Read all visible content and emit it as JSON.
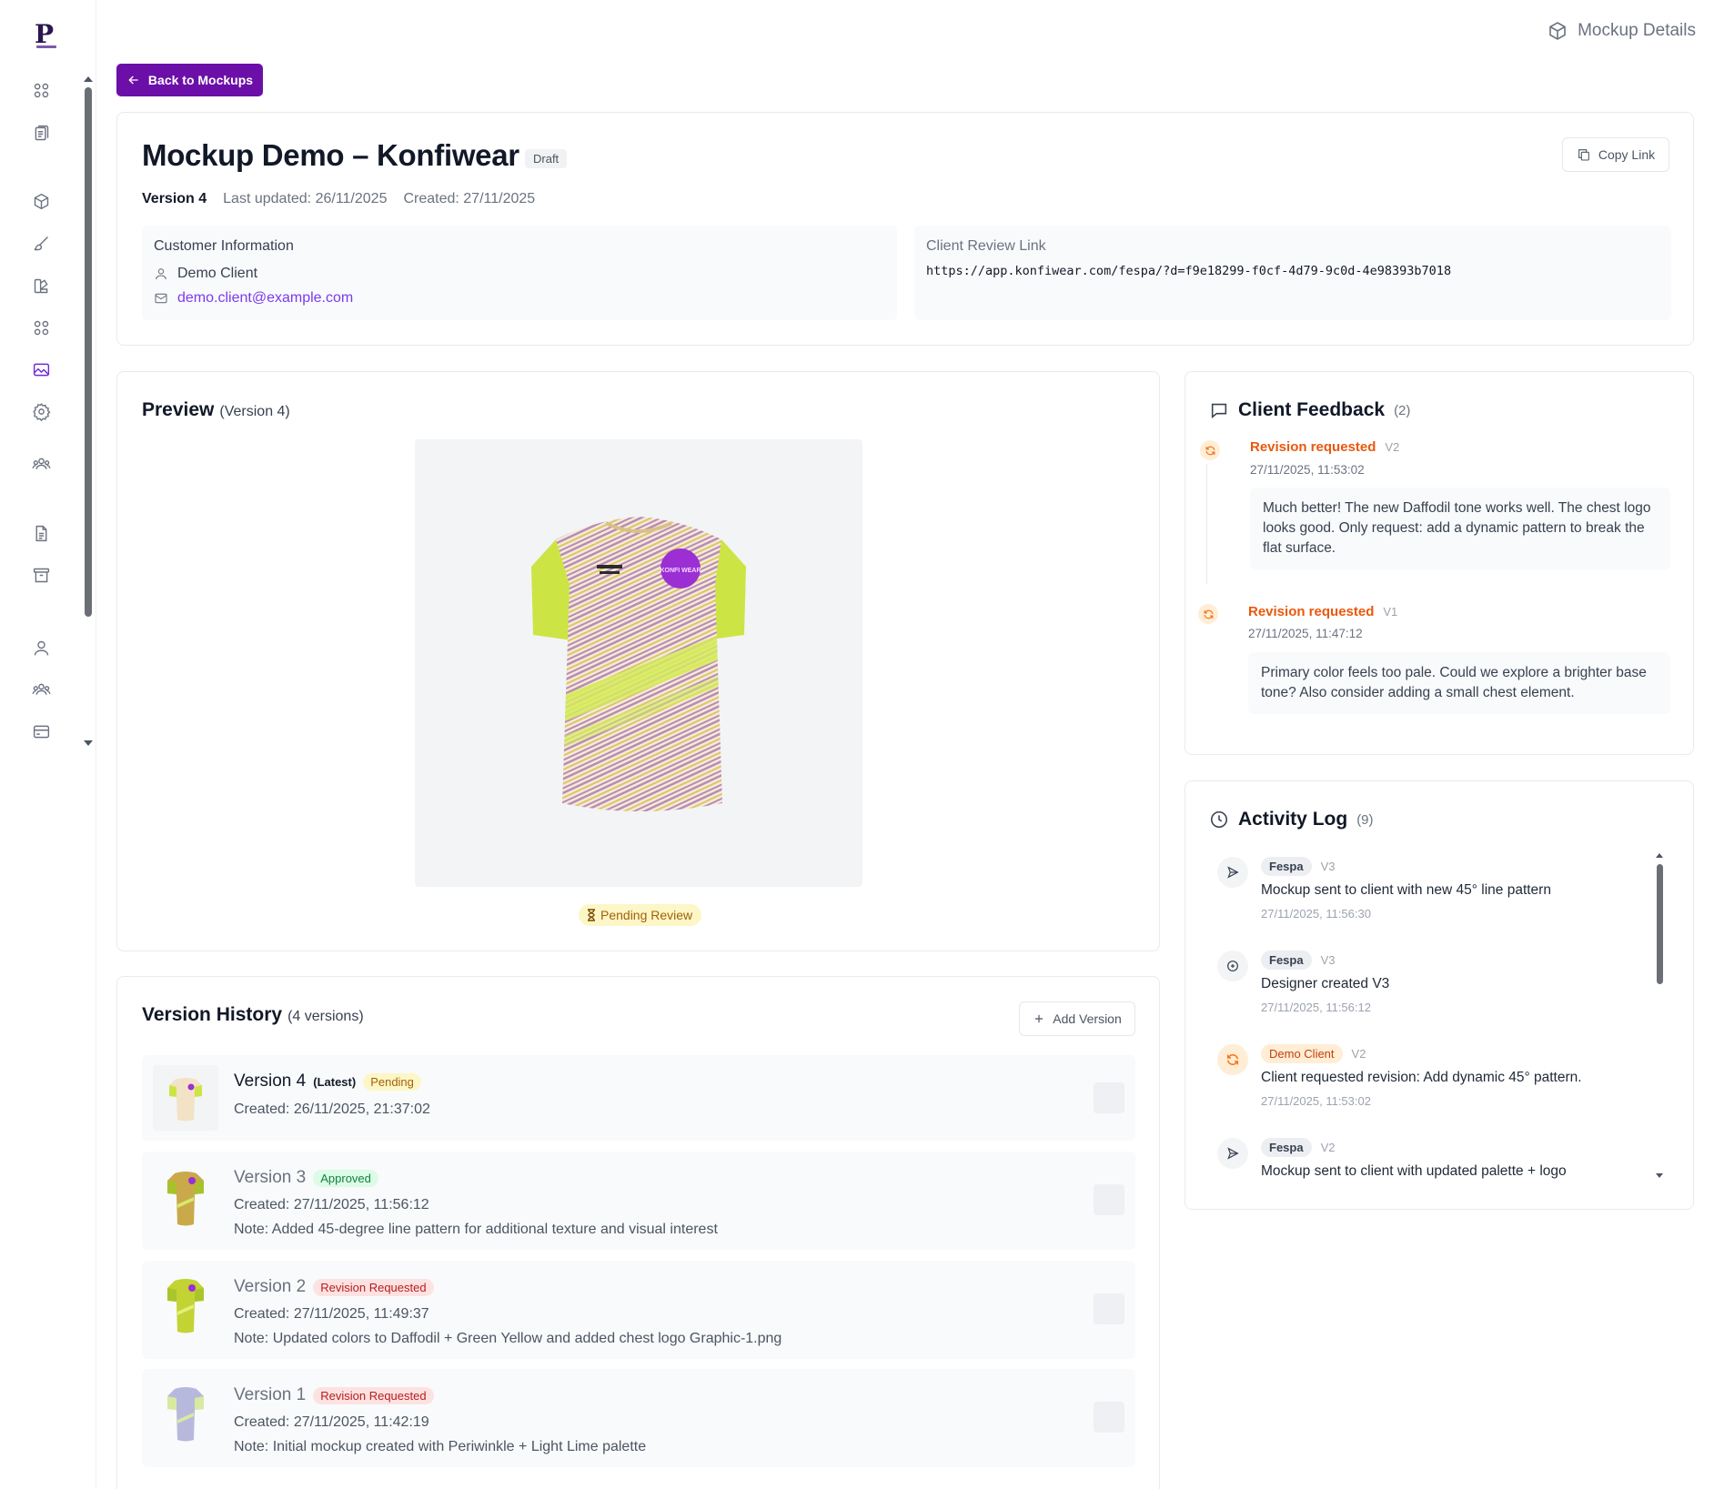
{
  "app": {
    "page_title": "Mockup Details",
    "back_label": "Back to Mockups"
  },
  "header": {
    "title": "Mockup Demo – Konfiwear",
    "status": "Draft",
    "copy_label": "Copy Link",
    "version": "Version 4",
    "last_updated": "Last updated: 26/11/2025",
    "created": "Created: 27/11/2025"
  },
  "customer": {
    "label": "Customer Information",
    "name": "Demo Client",
    "email": "demo.client@example.com"
  },
  "review_link": {
    "label": "Client Review Link",
    "url": "https://app.konfiwear.com/fespa/?d=f9e18299-f0cf-4d79-9c0d-4e98393b7018"
  },
  "preview": {
    "title": "Preview",
    "version": "(Version 4)",
    "status": "Pending Review",
    "logo_text": "KONFI WEAR"
  },
  "history": {
    "title": "Version History",
    "count": "(4 versions)",
    "add_label": "Add Version",
    "versions": [
      {
        "name": "Version 4",
        "tag": "(Latest)",
        "badge": "Pending",
        "created": "Created: 26/11/2025, 21:37:02",
        "note": ""
      },
      {
        "name": "Version 3",
        "tag": "",
        "badge": "Approved",
        "created": "Created: 27/11/2025, 11:56:12",
        "note": "Note: Added 45-degree line pattern for additional texture and visual interest"
      },
      {
        "name": "Version 2",
        "tag": "",
        "badge": "Revision Requested",
        "created": "Created: 27/11/2025, 11:49:37",
        "note": "Note: Updated colors to Daffodil + Green Yellow and added chest logo Graphic-1.png"
      },
      {
        "name": "Version 1",
        "tag": "",
        "badge": "Revision Requested",
        "created": "Created: 27/11/2025, 11:42:19",
        "note": "Note: Initial mockup created with Periwinkle + Light Lime palette"
      }
    ]
  },
  "feedback": {
    "title": "Client Feedback",
    "count": "(2)",
    "items": [
      {
        "status": "Revision requested",
        "version": "V2",
        "date": "27/11/2025, 11:53:02",
        "message": "Much better! The new Daffodil tone works well. The chest logo looks good. Only request: add a dynamic pattern to break the flat surface."
      },
      {
        "status": "Revision requested",
        "version": "V1",
        "date": "27/11/2025, 11:47:12",
        "message": "Primary color feels too pale. Could we explore a brighter base tone? Also consider adding a small chest element."
      }
    ]
  },
  "activity": {
    "title": "Activity Log",
    "count": "(9)",
    "items": [
      {
        "user": "Fespa",
        "version": "V3",
        "message": "Mockup sent to client with new 45° line pattern",
        "date": "27/11/2025, 11:56:30",
        "icon": "send-icon"
      },
      {
        "user": "Fespa",
        "version": "V3",
        "message": "Designer created V3",
        "date": "27/11/2025, 11:56:12",
        "icon": "plus-circle-icon"
      },
      {
        "user": "Demo Client",
        "version": "V2",
        "message": "Client requested revision: Add dynamic 45° pattern.",
        "date": "27/11/2025, 11:53:02",
        "icon": "refresh-icon"
      },
      {
        "user": "Fespa",
        "version": "V2",
        "message": "Mockup sent to client with updated palette + logo",
        "date": "",
        "icon": "send-icon"
      }
    ]
  },
  "colors": {
    "accent": "#6b0fa8",
    "revision": "#ea580c",
    "email": "#7c3aed"
  }
}
